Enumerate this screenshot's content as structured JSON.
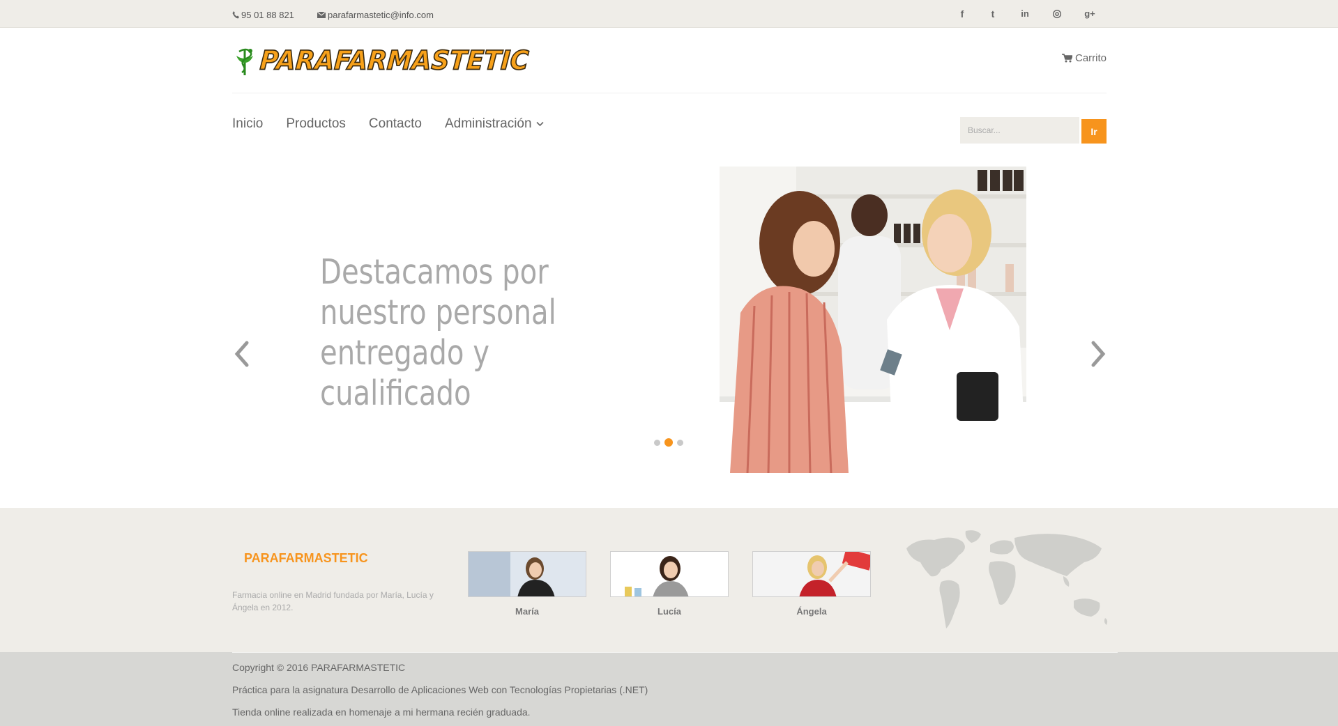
{
  "topbar": {
    "phone": "95 01 88 821",
    "email": "parafarmastetic@info.com",
    "social_icons": [
      "facebook-icon",
      "twitter-icon",
      "linkedin-icon",
      "dribbble-icon",
      "google-plus-icon"
    ],
    "social_glyphs": [
      "f",
      "t",
      "in",
      "◎",
      "g+"
    ]
  },
  "header": {
    "logo_text": "PARAFARMASTETIC",
    "cart_label": "Carrito"
  },
  "nav": {
    "items": [
      "Inicio",
      "Productos",
      "Contacto",
      "Administración"
    ]
  },
  "search": {
    "placeholder": "Buscar...",
    "button_label": "Ir"
  },
  "slider": {
    "heading": "Destacamos por nuestro personal entregado y cualificado",
    "slide_count": 3,
    "active_slide": 2
  },
  "footer": {
    "brand": "PARAFARMASTETIC",
    "description": "Farmacia online en Madrid fundada por María, Lucía y Ángela en 2012.",
    "members": [
      "María",
      "Lucía",
      "Ángela"
    ],
    "copyright": "Copyright © 2016 PARAFARMASTETIC",
    "line2": "Práctica para la asignatura Desarrollo de Aplicaciones Web con Tecnologías Propietarias (.NET)",
    "line3": "Tienda online realizada en homenaje a mi hermana recién graduada."
  },
  "colors": {
    "accent": "#f7941d",
    "topbar_bg": "#efede8",
    "footer_bottom_bg": "#d7d7d4"
  }
}
